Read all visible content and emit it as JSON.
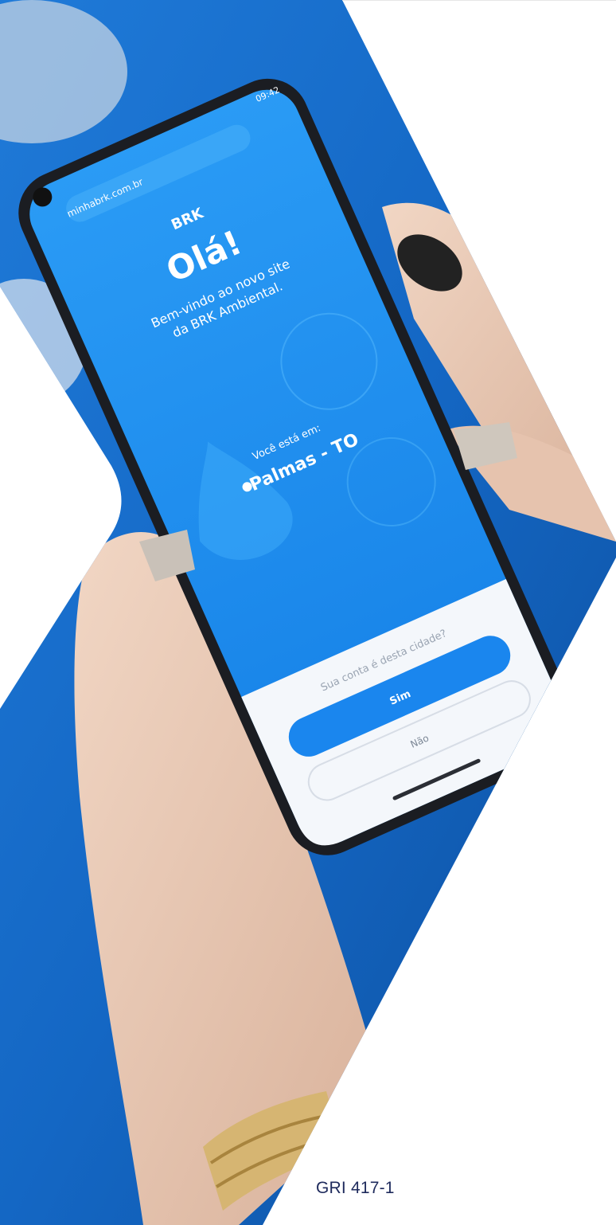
{
  "phone": {
    "url": "minhabrk.com.br",
    "status_time": "09:42",
    "brand": "BRK",
    "greeting": "Olá!",
    "welcome_line1": "Bem-vindo ao novo site",
    "welcome_line2": "da BRK Ambiental.",
    "location_label": "Você está em:",
    "location_value": "Palmas - TO",
    "sheet_question": "Sua conta é desta cidade?",
    "primary_button": "Sim",
    "secondary_button": "Não"
  },
  "footer": {
    "gri_code": "GRI 417-1"
  },
  "colors": {
    "screen_blue": "#1e90f0",
    "background_blue": "#1769c8",
    "footer_text": "#1e2a5c"
  }
}
